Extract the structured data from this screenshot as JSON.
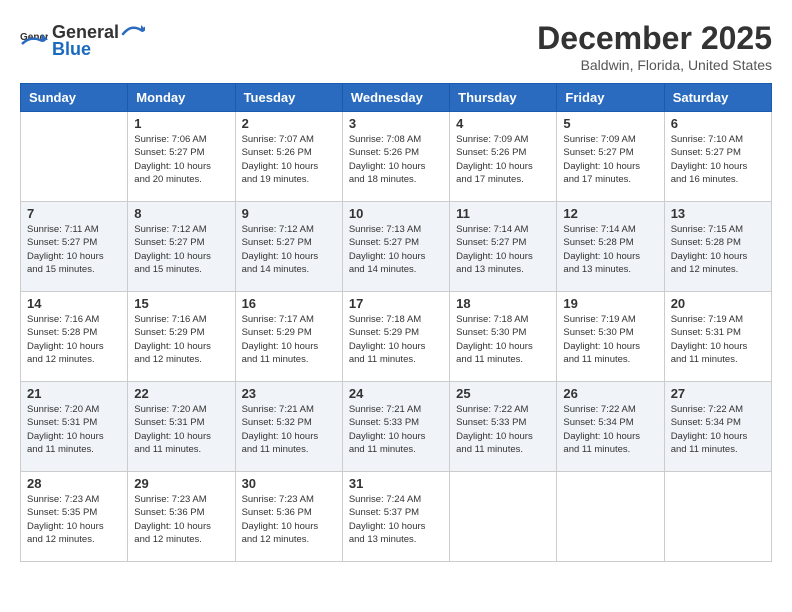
{
  "logo": {
    "general": "General",
    "blue": "Blue"
  },
  "title": "December 2025",
  "location": "Baldwin, Florida, United States",
  "days_of_week": [
    "Sunday",
    "Monday",
    "Tuesday",
    "Wednesday",
    "Thursday",
    "Friday",
    "Saturday"
  ],
  "weeks": [
    [
      {
        "day": "",
        "sunrise": "",
        "sunset": "",
        "daylight": ""
      },
      {
        "day": "1",
        "sunrise": "Sunrise: 7:06 AM",
        "sunset": "Sunset: 5:27 PM",
        "daylight": "Daylight: 10 hours and 20 minutes."
      },
      {
        "day": "2",
        "sunrise": "Sunrise: 7:07 AM",
        "sunset": "Sunset: 5:26 PM",
        "daylight": "Daylight: 10 hours and 19 minutes."
      },
      {
        "day": "3",
        "sunrise": "Sunrise: 7:08 AM",
        "sunset": "Sunset: 5:26 PM",
        "daylight": "Daylight: 10 hours and 18 minutes."
      },
      {
        "day": "4",
        "sunrise": "Sunrise: 7:09 AM",
        "sunset": "Sunset: 5:26 PM",
        "daylight": "Daylight: 10 hours and 17 minutes."
      },
      {
        "day": "5",
        "sunrise": "Sunrise: 7:09 AM",
        "sunset": "Sunset: 5:27 PM",
        "daylight": "Daylight: 10 hours and 17 minutes."
      },
      {
        "day": "6",
        "sunrise": "Sunrise: 7:10 AM",
        "sunset": "Sunset: 5:27 PM",
        "daylight": "Daylight: 10 hours and 16 minutes."
      }
    ],
    [
      {
        "day": "7",
        "sunrise": "Sunrise: 7:11 AM",
        "sunset": "Sunset: 5:27 PM",
        "daylight": "Daylight: 10 hours and 15 minutes."
      },
      {
        "day": "8",
        "sunrise": "Sunrise: 7:12 AM",
        "sunset": "Sunset: 5:27 PM",
        "daylight": "Daylight: 10 hours and 15 minutes."
      },
      {
        "day": "9",
        "sunrise": "Sunrise: 7:12 AM",
        "sunset": "Sunset: 5:27 PM",
        "daylight": "Daylight: 10 hours and 14 minutes."
      },
      {
        "day": "10",
        "sunrise": "Sunrise: 7:13 AM",
        "sunset": "Sunset: 5:27 PM",
        "daylight": "Daylight: 10 hours and 14 minutes."
      },
      {
        "day": "11",
        "sunrise": "Sunrise: 7:14 AM",
        "sunset": "Sunset: 5:27 PM",
        "daylight": "Daylight: 10 hours and 13 minutes."
      },
      {
        "day": "12",
        "sunrise": "Sunrise: 7:14 AM",
        "sunset": "Sunset: 5:28 PM",
        "daylight": "Daylight: 10 hours and 13 minutes."
      },
      {
        "day": "13",
        "sunrise": "Sunrise: 7:15 AM",
        "sunset": "Sunset: 5:28 PM",
        "daylight": "Daylight: 10 hours and 12 minutes."
      }
    ],
    [
      {
        "day": "14",
        "sunrise": "Sunrise: 7:16 AM",
        "sunset": "Sunset: 5:28 PM",
        "daylight": "Daylight: 10 hours and 12 minutes."
      },
      {
        "day": "15",
        "sunrise": "Sunrise: 7:16 AM",
        "sunset": "Sunset: 5:29 PM",
        "daylight": "Daylight: 10 hours and 12 minutes."
      },
      {
        "day": "16",
        "sunrise": "Sunrise: 7:17 AM",
        "sunset": "Sunset: 5:29 PM",
        "daylight": "Daylight: 10 hours and 11 minutes."
      },
      {
        "day": "17",
        "sunrise": "Sunrise: 7:18 AM",
        "sunset": "Sunset: 5:29 PM",
        "daylight": "Daylight: 10 hours and 11 minutes."
      },
      {
        "day": "18",
        "sunrise": "Sunrise: 7:18 AM",
        "sunset": "Sunset: 5:30 PM",
        "daylight": "Daylight: 10 hours and 11 minutes."
      },
      {
        "day": "19",
        "sunrise": "Sunrise: 7:19 AM",
        "sunset": "Sunset: 5:30 PM",
        "daylight": "Daylight: 10 hours and 11 minutes."
      },
      {
        "day": "20",
        "sunrise": "Sunrise: 7:19 AM",
        "sunset": "Sunset: 5:31 PM",
        "daylight": "Daylight: 10 hours and 11 minutes."
      }
    ],
    [
      {
        "day": "21",
        "sunrise": "Sunrise: 7:20 AM",
        "sunset": "Sunset: 5:31 PM",
        "daylight": "Daylight: 10 hours and 11 minutes."
      },
      {
        "day": "22",
        "sunrise": "Sunrise: 7:20 AM",
        "sunset": "Sunset: 5:31 PM",
        "daylight": "Daylight: 10 hours and 11 minutes."
      },
      {
        "day": "23",
        "sunrise": "Sunrise: 7:21 AM",
        "sunset": "Sunset: 5:32 PM",
        "daylight": "Daylight: 10 hours and 11 minutes."
      },
      {
        "day": "24",
        "sunrise": "Sunrise: 7:21 AM",
        "sunset": "Sunset: 5:33 PM",
        "daylight": "Daylight: 10 hours and 11 minutes."
      },
      {
        "day": "25",
        "sunrise": "Sunrise: 7:22 AM",
        "sunset": "Sunset: 5:33 PM",
        "daylight": "Daylight: 10 hours and 11 minutes."
      },
      {
        "day": "26",
        "sunrise": "Sunrise: 7:22 AM",
        "sunset": "Sunset: 5:34 PM",
        "daylight": "Daylight: 10 hours and 11 minutes."
      },
      {
        "day": "27",
        "sunrise": "Sunrise: 7:22 AM",
        "sunset": "Sunset: 5:34 PM",
        "daylight": "Daylight: 10 hours and 11 minutes."
      }
    ],
    [
      {
        "day": "28",
        "sunrise": "Sunrise: 7:23 AM",
        "sunset": "Sunset: 5:35 PM",
        "daylight": "Daylight: 10 hours and 12 minutes."
      },
      {
        "day": "29",
        "sunrise": "Sunrise: 7:23 AM",
        "sunset": "Sunset: 5:36 PM",
        "daylight": "Daylight: 10 hours and 12 minutes."
      },
      {
        "day": "30",
        "sunrise": "Sunrise: 7:23 AM",
        "sunset": "Sunset: 5:36 PM",
        "daylight": "Daylight: 10 hours and 12 minutes."
      },
      {
        "day": "31",
        "sunrise": "Sunrise: 7:24 AM",
        "sunset": "Sunset: 5:37 PM",
        "daylight": "Daylight: 10 hours and 13 minutes."
      },
      {
        "day": "",
        "sunrise": "",
        "sunset": "",
        "daylight": ""
      },
      {
        "day": "",
        "sunrise": "",
        "sunset": "",
        "daylight": ""
      },
      {
        "day": "",
        "sunrise": "",
        "sunset": "",
        "daylight": ""
      }
    ]
  ]
}
